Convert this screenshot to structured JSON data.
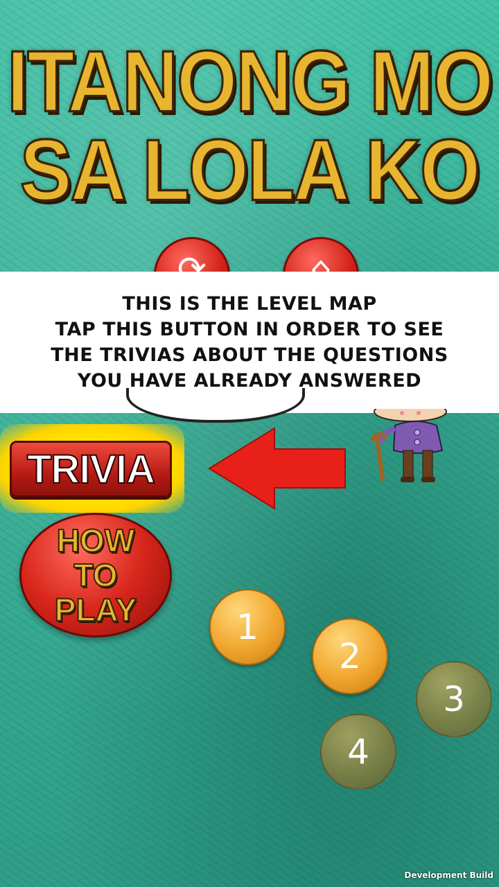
{
  "title": {
    "line1": "ITANONG MO",
    "line2": "SA LOLA KO"
  },
  "top_buttons": [
    {
      "name": "restart",
      "icon": "refresh-icon",
      "glyph": "⟳"
    },
    {
      "name": "home",
      "icon": "home-icon",
      "glyph": "⌂"
    }
  ],
  "tutorial": {
    "lines": [
      "THIS IS THE LEVEL MAP",
      "TAP THIS BUTTON IN ORDER TO SEE",
      "THE TRIVIAS ABOUT THE QUESTIONS",
      "YOU HAVE ALREADY ANSWERED"
    ]
  },
  "trivia_button": {
    "label": "TRIVIA"
  },
  "how_to_play": {
    "lines": [
      "HOW",
      "TO",
      "PLAY"
    ]
  },
  "levels": [
    {
      "label": "1",
      "state": "unlocked"
    },
    {
      "label": "2",
      "state": "unlocked"
    },
    {
      "label": "3",
      "state": "locked"
    },
    {
      "label": "4",
      "state": "locked"
    }
  ],
  "footer": {
    "dev_build": "Development Build"
  },
  "colors": {
    "background": "#3fb39c",
    "title_gold": "#e8b530",
    "button_red": "#d3241b",
    "highlight_yellow": "#ffe600",
    "arrow_red": "#e8201a",
    "level_orange": "#f0a62e"
  }
}
